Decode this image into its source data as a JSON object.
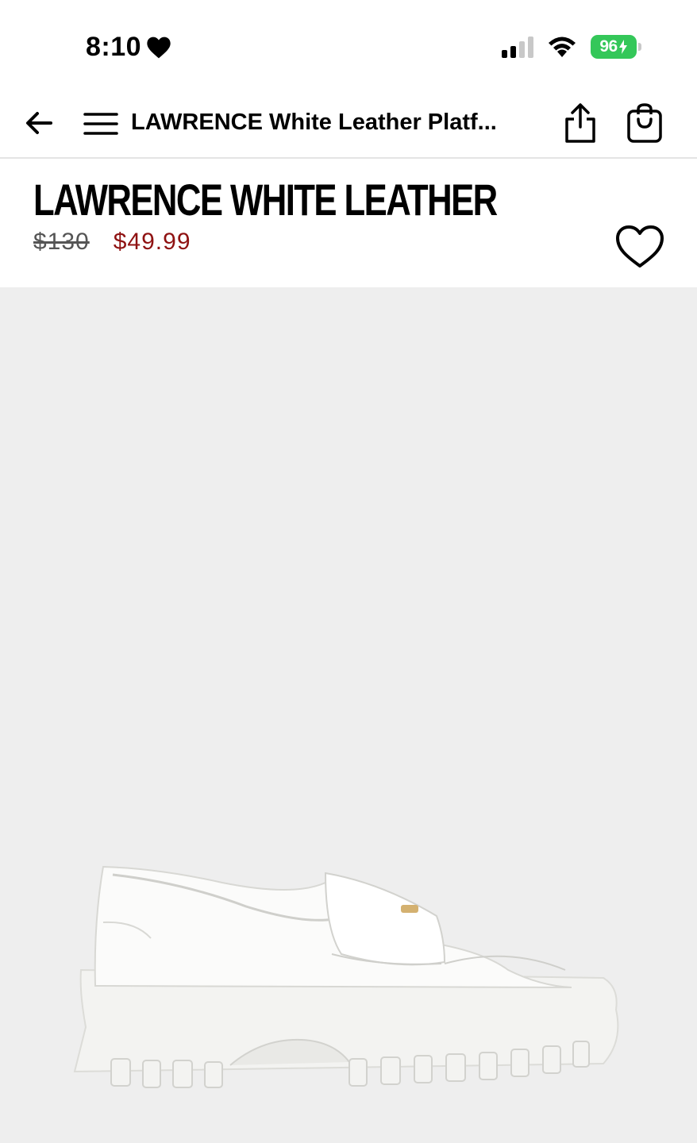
{
  "status_bar": {
    "time": "8:10",
    "battery": "96"
  },
  "nav": {
    "title": "LAWRENCE White Leather Platf..."
  },
  "product": {
    "name": "LAWRENCE WHITE LEATHER",
    "price_original": "$130",
    "price_sale": "$49.99",
    "image_alt": "White leather platform loafer"
  },
  "colors": {
    "sale_price": "#8f1212",
    "battery": "#34c759",
    "image_background": "#eeeeee"
  },
  "icons": [
    "heart-icon",
    "signal-icon",
    "wifi-icon",
    "battery-icon",
    "back-arrow-icon",
    "menu-icon",
    "share-icon",
    "shopping-bag-icon",
    "wishlist-heart-icon"
  ]
}
